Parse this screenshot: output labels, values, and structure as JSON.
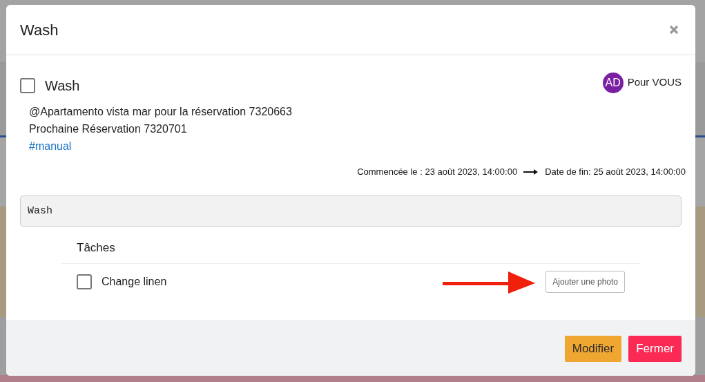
{
  "modal": {
    "title": "Wash"
  },
  "task": {
    "title": "Wash",
    "checked": false
  },
  "assignee": {
    "initials": "AD",
    "label": "Pour VOUS",
    "color": "#7b1fa2"
  },
  "description": [
    "@Apartamento vista mar pour la réservation 7320663",
    "Prochaine Réservation 7320701"
  ],
  "tag": "#manual",
  "dates": {
    "start": "Commencée le : 23 août 2023, 14:00:00",
    "end": "Date de fin: 25 août 2023, 14:00:00"
  },
  "name_field": {
    "value": "Wash"
  },
  "subtasks_heading": "Tâches",
  "subtasks": [
    {
      "label": "Change linen",
      "checked": false,
      "action": "Ajouter une photo"
    }
  ],
  "buttons": [
    {
      "label": "Modifier",
      "kind": "primary"
    },
    {
      "label": "Fermer",
      "kind": "danger"
    }
  ]
}
